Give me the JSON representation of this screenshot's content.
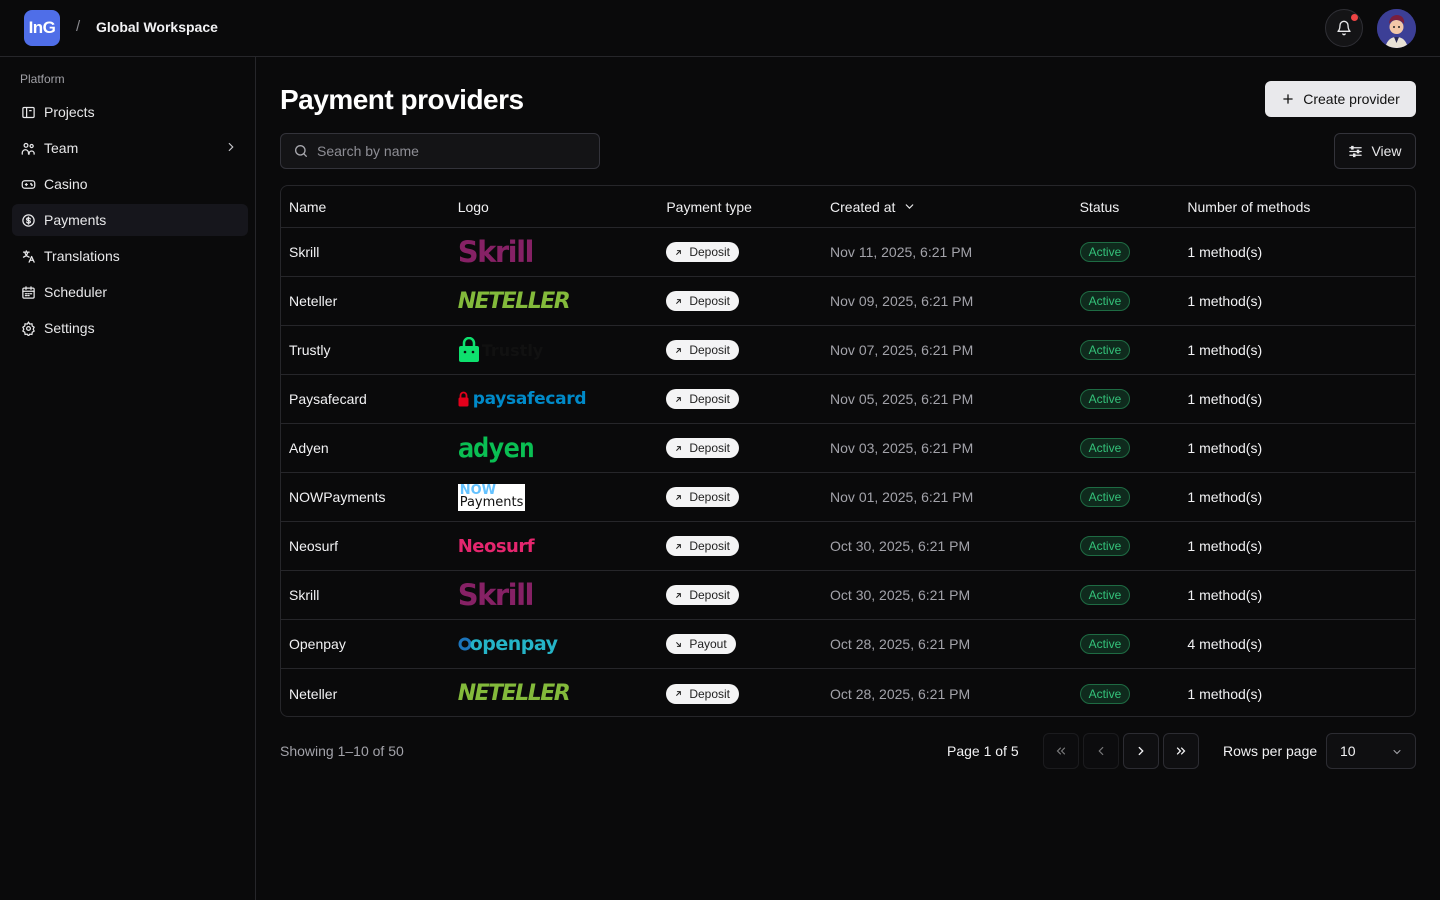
{
  "brand": {
    "logo_text": "InG",
    "separator": "/",
    "workspace": "Global Workspace",
    "color": "#4f6ee8"
  },
  "sidebar": {
    "section": "Platform",
    "items": [
      {
        "label": "Projects",
        "icon": "folder-icon"
      },
      {
        "label": "Team",
        "icon": "team-icon",
        "has_chevron": true
      },
      {
        "label": "Casino",
        "icon": "gamepad-icon"
      },
      {
        "label": "Payments",
        "icon": "coin-icon",
        "active": true
      },
      {
        "label": "Translations",
        "icon": "translate-icon"
      },
      {
        "label": "Scheduler",
        "icon": "calendar-icon"
      },
      {
        "label": "Settings",
        "icon": "gear-icon"
      }
    ]
  },
  "page": {
    "title": "Payment providers",
    "create_label": "Create provider",
    "search_placeholder": "Search by name",
    "view_label": "View"
  },
  "table": {
    "columns": [
      "Name",
      "Logo",
      "Payment type",
      "Created at",
      "Status",
      "Number of methods"
    ],
    "rows": [
      {
        "name": "Skrill",
        "logo": "skrill",
        "type": "Deposit",
        "created": "Nov 11, 2025, 6:21 PM",
        "status": "Active",
        "methods": "1 method(s)"
      },
      {
        "name": "Neteller",
        "logo": "neteller",
        "type": "Deposit",
        "created": "Nov 09, 2025, 6:21 PM",
        "status": "Active",
        "methods": "1 method(s)"
      },
      {
        "name": "Trustly",
        "logo": "trustly",
        "type": "Deposit",
        "created": "Nov 07, 2025, 6:21 PM",
        "status": "Active",
        "methods": "1 method(s)"
      },
      {
        "name": "Paysafecard",
        "logo": "paysafecard",
        "type": "Deposit",
        "created": "Nov 05, 2025, 6:21 PM",
        "status": "Active",
        "methods": "1 method(s)"
      },
      {
        "name": "Adyen",
        "logo": "adyen",
        "type": "Deposit",
        "created": "Nov 03, 2025, 6:21 PM",
        "status": "Active",
        "methods": "1 method(s)"
      },
      {
        "name": "NOWPayments",
        "logo": "nowpayments",
        "type": "Deposit",
        "created": "Nov 01, 2025, 6:21 PM",
        "status": "Active",
        "methods": "1 method(s)"
      },
      {
        "name": "Neosurf",
        "logo": "neosurf",
        "type": "Deposit",
        "created": "Oct 30, 2025, 6:21 PM",
        "status": "Active",
        "methods": "1 method(s)"
      },
      {
        "name": "Skrill",
        "logo": "skrill",
        "type": "Deposit",
        "created": "Oct 30, 2025, 6:21 PM",
        "status": "Active",
        "methods": "1 method(s)"
      },
      {
        "name": "Openpay",
        "logo": "openpay",
        "type": "Payout",
        "created": "Oct 28, 2025, 6:21 PM",
        "status": "Active",
        "methods": "4 method(s)"
      },
      {
        "name": "Neteller",
        "logo": "neteller",
        "type": "Deposit",
        "created": "Oct 28, 2025, 6:21 PM",
        "status": "Active",
        "methods": "1 method(s)"
      }
    ]
  },
  "logos": {
    "skrill": {
      "text": "Skrill",
      "color": "#862165"
    },
    "neteller": {
      "text": "NETELLER",
      "color": "#83ba3b"
    },
    "trustly": {
      "text": "Trustly",
      "color": "#0ee06e"
    },
    "paysafecard": {
      "text": "paysafecard",
      "color": "#008ac9"
    },
    "adyen": {
      "text": "adyen",
      "color": "#0abf53"
    },
    "nowpayments": {
      "top": "NOW",
      "bottom": "Payments"
    },
    "neosurf": {
      "text": "Neosurf",
      "color": "#e5266e"
    },
    "openpay": {
      "text": "openpay",
      "color": "#25b4c7"
    }
  },
  "footer": {
    "showing": "Showing 1–10 of 50",
    "page_info": "Page 1 of 5",
    "rows_label": "Rows per page",
    "rows_value": "10"
  }
}
